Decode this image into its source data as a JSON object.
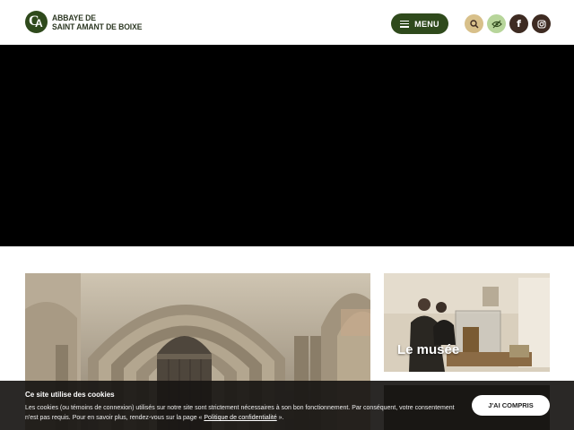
{
  "header": {
    "logo_line1": "ABBAYE DE",
    "logo_line2": "SAINT AMANT DE BOIXE",
    "menu_label": "MENU",
    "icons": [
      "search-icon",
      "eye-slash-icon",
      "facebook-icon",
      "instagram-icon"
    ],
    "colors": {
      "brand": "#2f4a1c",
      "search_bg": "#d8c08a",
      "eye_bg": "#b7d59a",
      "social_bg": "#3e2b22"
    }
  },
  "cards": {
    "musee_title": "Le musée"
  },
  "cookie": {
    "title": "Ce site utilise des cookies",
    "text_before": "Les cookies (ou témoins de connexion) utilisés sur notre site sont strictement nécessaires à son bon fonctionnement. Par conséquent, votre consentement n'est pas requis. Pour en savoir plus, rendez-vous sur la page « ",
    "link": "Politique de confidentialité",
    "text_after": " ».",
    "button": "J'AI COMPRIS"
  }
}
